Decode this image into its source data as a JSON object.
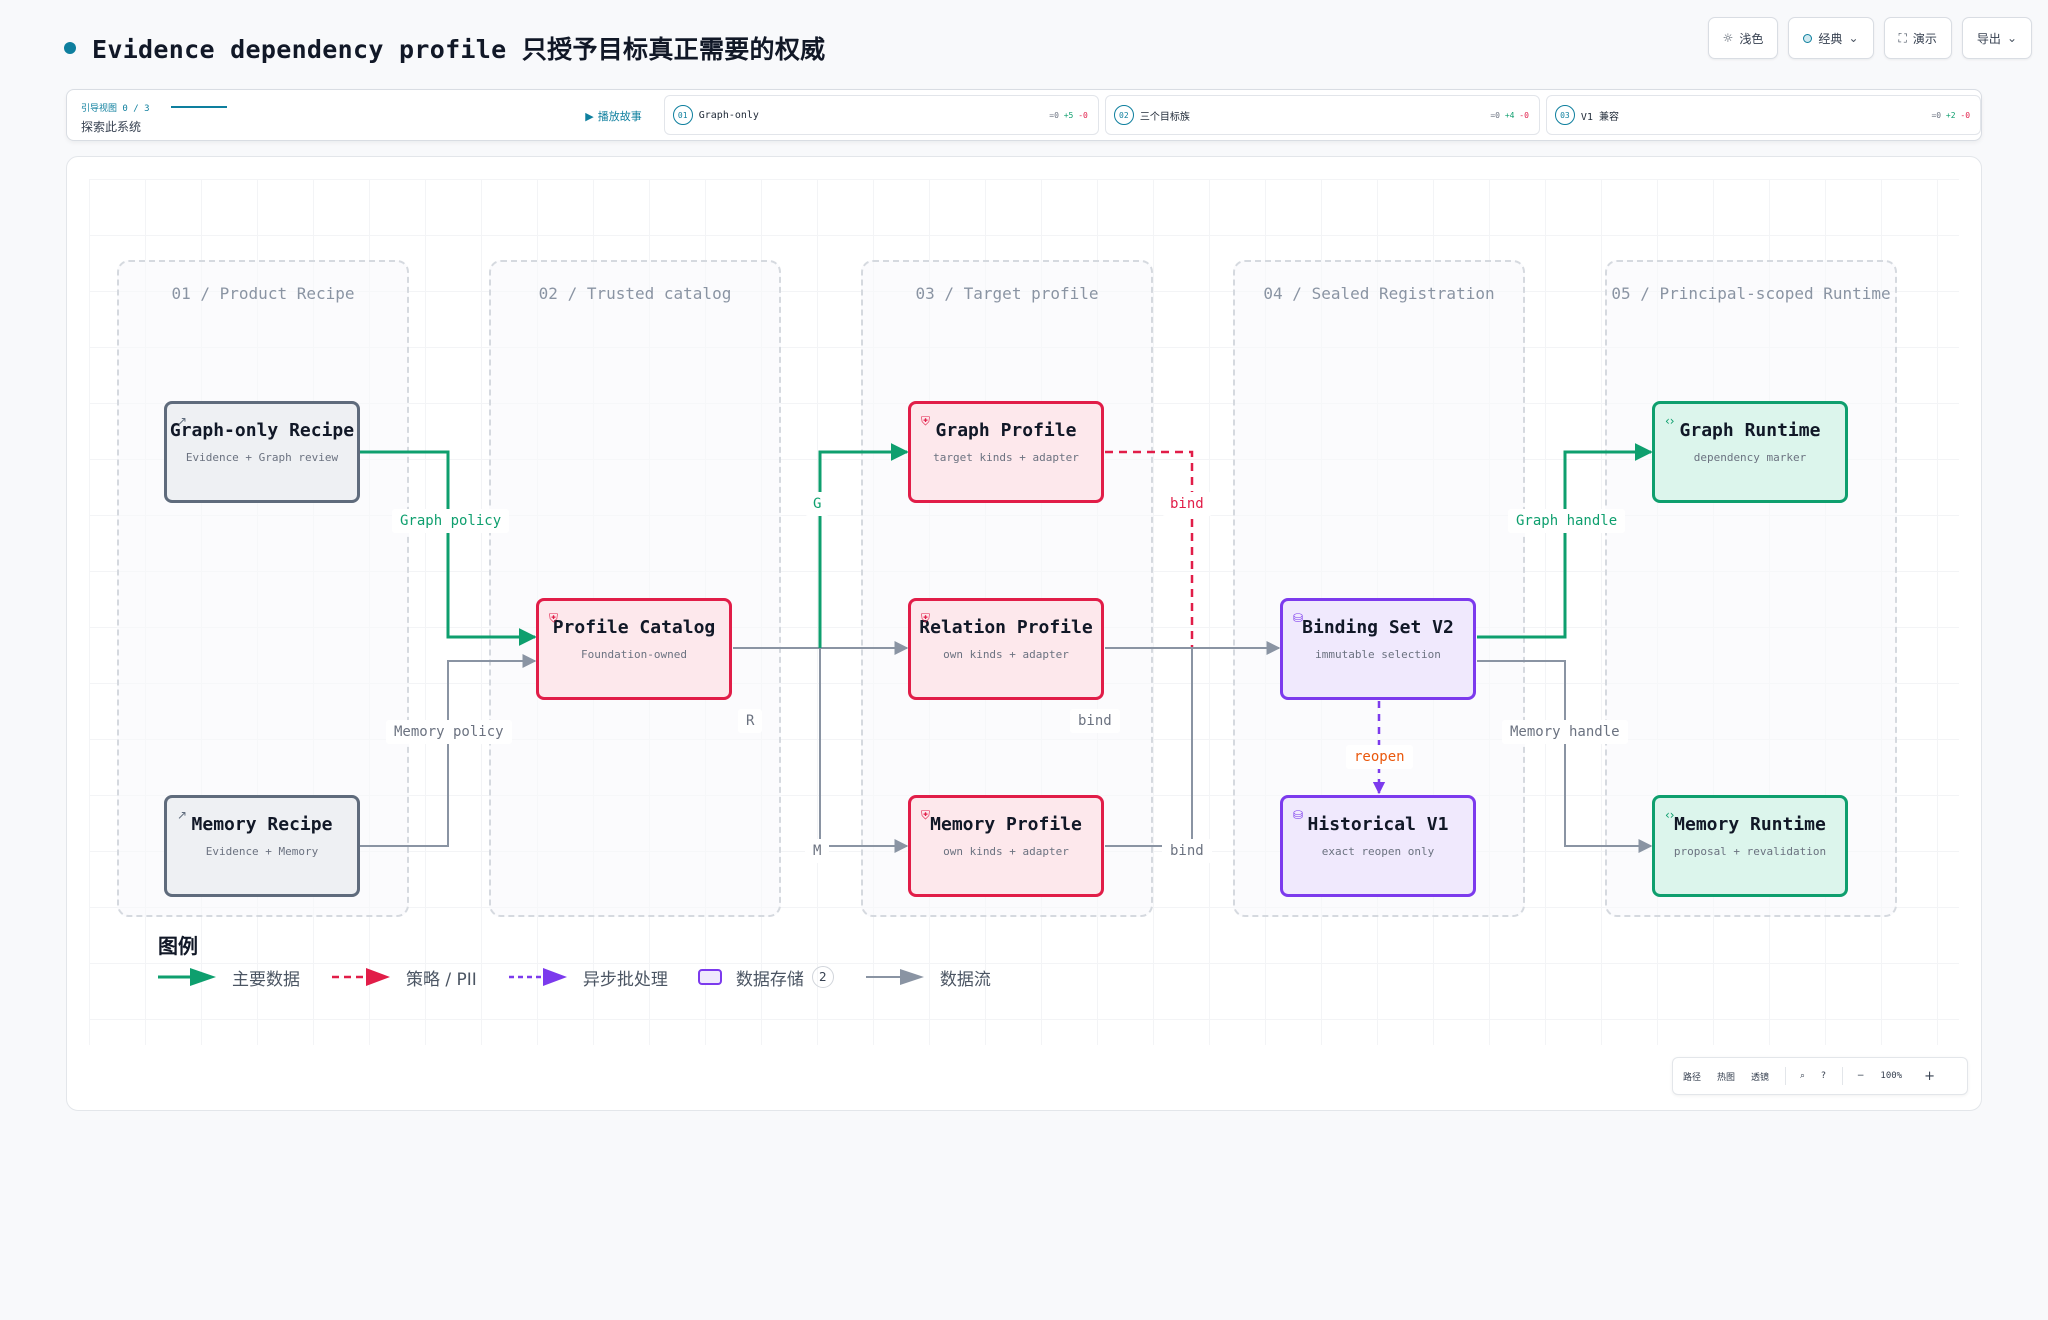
{
  "header": {
    "title_prefix": "Evidence dependency profile",
    "title_suffix": "只授予目标真正需要的权威"
  },
  "toolbar": {
    "theme_label": "浅色",
    "style_label": "经典",
    "present_label": "演示",
    "export_label": "导出"
  },
  "story": {
    "kicker": "引导视图  0 / 3",
    "subtitle": "探索此系统",
    "play_label": "播放故事",
    "steps": [
      {
        "num": "01",
        "label": "Graph-only",
        "eq": "=0",
        "plus": "+5",
        "minus": "-0"
      },
      {
        "num": "02",
        "label": "三个目标族",
        "eq": "=0",
        "plus": "+4",
        "minus": "-0"
      },
      {
        "num": "03",
        "label": "V1 兼容",
        "eq": "=0",
        "plus": "+2",
        "minus": "-0"
      }
    ]
  },
  "lanes": [
    {
      "title": "01 / Product Recipe"
    },
    {
      "title": "02 / Trusted catalog"
    },
    {
      "title": "03 / Target profile"
    },
    {
      "title": "04 / Sealed Registration"
    },
    {
      "title": "05 / Principal-scoped Runtime"
    }
  ],
  "nodes": {
    "graph_recipe": {
      "title": "Graph-only Recipe",
      "sub": "Evidence + Graph review"
    },
    "memory_recipe": {
      "title": "Memory Recipe",
      "sub": "Evidence + Memory"
    },
    "profile_catalog": {
      "title": "Profile Catalog",
      "sub": "Foundation-owned"
    },
    "graph_profile": {
      "title": "Graph Profile",
      "sub": "target kinds + adapter"
    },
    "relation_profile": {
      "title": "Relation Profile",
      "sub": "own kinds + adapter"
    },
    "memory_profile": {
      "title": "Memory Profile",
      "sub": "own kinds + adapter"
    },
    "binding_set": {
      "title": "Binding Set V2",
      "sub": "immutable selection"
    },
    "historical": {
      "title": "Historical V1",
      "sub": "exact reopen only"
    },
    "graph_runtime": {
      "title": "Graph Runtime",
      "sub": "dependency marker"
    },
    "memory_runtime": {
      "title": "Memory Runtime",
      "sub": "proposal + revalidation"
    }
  },
  "edge_labels": {
    "graph_policy": "Graph policy",
    "memory_policy": "Memory policy",
    "g": "G",
    "r": "R",
    "m": "M",
    "bind_red": "bind",
    "bind_mid": "bind",
    "bind_low": "bind",
    "reopen": "reopen",
    "graph_handle": "Graph handle",
    "memory_handle": "Memory handle"
  },
  "legend": {
    "title": "图例",
    "main_data": "主要数据",
    "policy": "策略 / PII",
    "async": "异步批处理",
    "store": "数据存储",
    "store_count": "2",
    "flow": "数据流"
  },
  "zoom": {
    "path": "路径",
    "focus": "热图",
    "lens": "透镜",
    "search_icon": "⌕",
    "help_icon": "?",
    "minus": "−",
    "percent": "100%",
    "plus": "+"
  },
  "colors": {
    "accent": "#0e7f9e",
    "green": "#0e9f6e",
    "red": "#e11d48",
    "purple": "#7c3aed",
    "gray": "#8a94a3"
  }
}
